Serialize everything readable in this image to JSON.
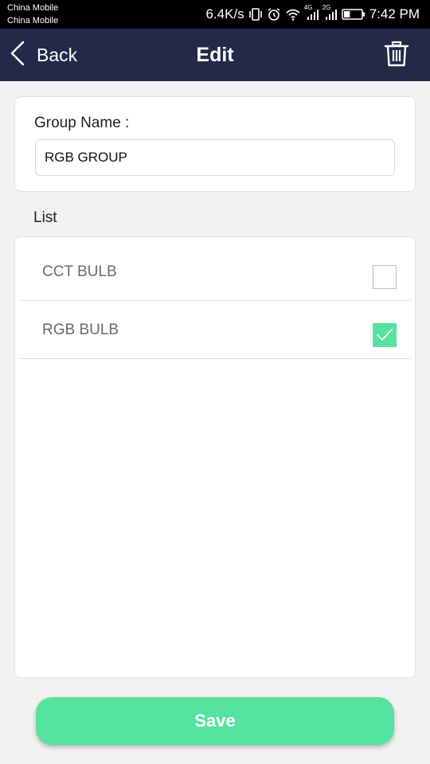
{
  "status_bar": {
    "carrier_1": "China Mobile",
    "carrier_2": "China Mobile",
    "net_speed": "6.4K/s",
    "network_4g": "4G",
    "network_2g": "2G",
    "time": "7:42 PM",
    "battery_level": 0.35
  },
  "nav": {
    "back_label": "Back",
    "title": "Edit",
    "delete_icon": "trash-icon"
  },
  "group": {
    "label": "Group Name :",
    "value": "RGB GROUP"
  },
  "list": {
    "heading": "List",
    "items": [
      {
        "label": "CCT BULB",
        "checked": false
      },
      {
        "label": "RGB BULB",
        "checked": true
      }
    ]
  },
  "save": {
    "label": "Save"
  },
  "colors": {
    "nav_background": "#232949",
    "accent_green": "#55e39f",
    "page_background": "#f2f2f2"
  }
}
